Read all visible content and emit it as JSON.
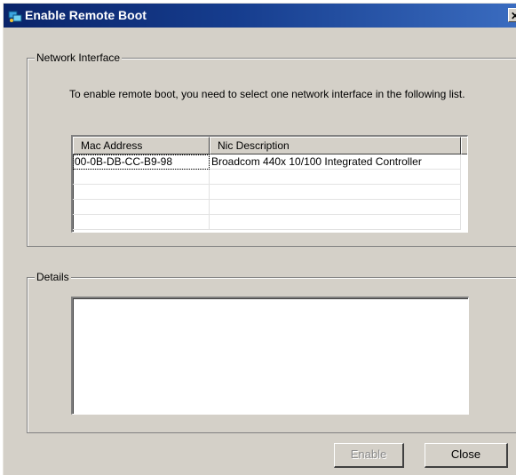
{
  "window": {
    "title": "Enable Remote Boot",
    "close_glyph": "✕"
  },
  "network_group": {
    "label": "Network Interface",
    "instruction": "To enable remote boot, you need to select one network interface in the following list."
  },
  "table": {
    "columns": [
      "Mac Address",
      "Nic Description"
    ],
    "rows": [
      {
        "mac": "00-0B-DB-CC-B9-98",
        "description": "Broadcom 440x 10/100 Integrated Controller"
      }
    ]
  },
  "details_group": {
    "label": "Details",
    "text": ""
  },
  "buttons": {
    "enable": "Enable",
    "close": "Close"
  },
  "icons": {
    "title_icon": "remote-boot-icon"
  }
}
